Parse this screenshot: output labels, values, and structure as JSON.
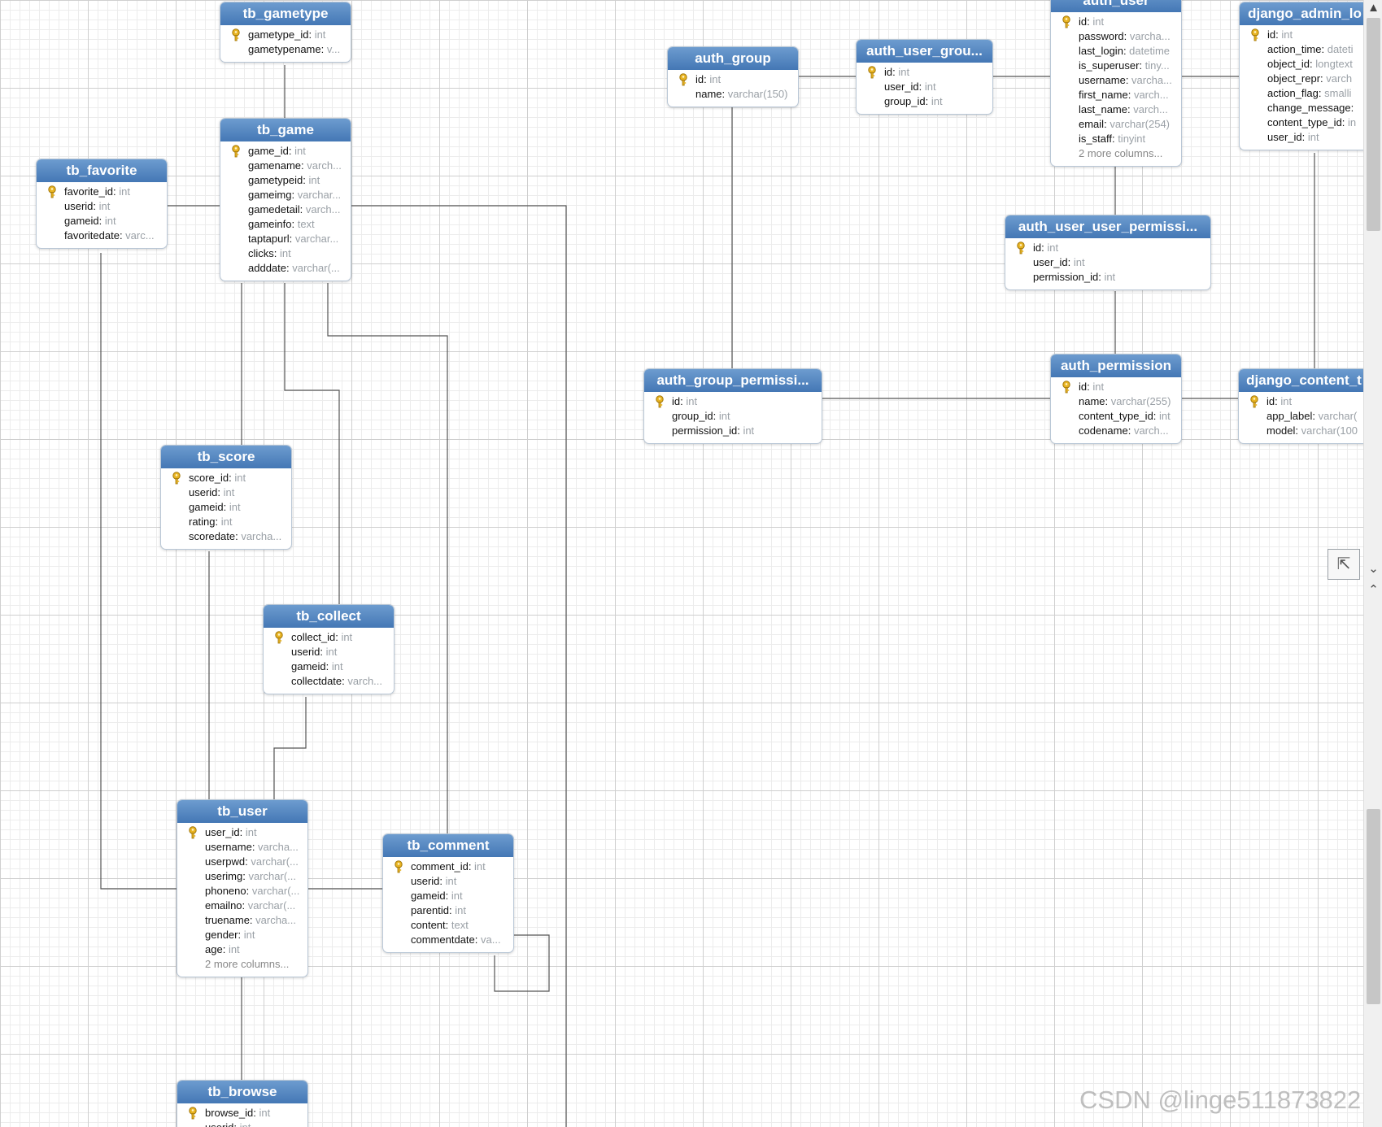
{
  "tables": [
    {
      "id": "tb_gametype",
      "name": "tb_gametype",
      "pos": [
        270,
        2,
        160
      ],
      "fields": [
        {
          "pk": true,
          "name": "gametype_id",
          "type": "int"
        },
        {
          "name": "gametypename",
          "type": "v..."
        }
      ]
    },
    {
      "id": "tb_game",
      "name": "tb_game",
      "pos": [
        270,
        145,
        160
      ],
      "fields": [
        {
          "pk": true,
          "name": "game_id",
          "type": "int"
        },
        {
          "name": "gamename",
          "type": "varch..."
        },
        {
          "name": "gametypeid",
          "type": "int"
        },
        {
          "name": "gameimg",
          "type": "varchar..."
        },
        {
          "name": "gamedetail",
          "type": "varch..."
        },
        {
          "name": "gameinfo",
          "type": "text"
        },
        {
          "name": "taptapurl",
          "type": "varchar..."
        },
        {
          "name": "clicks",
          "type": "int"
        },
        {
          "name": "adddate",
          "type": "varchar(..."
        }
      ]
    },
    {
      "id": "tb_favorite",
      "name": "tb_favorite",
      "pos": [
        44,
        195,
        160
      ],
      "fields": [
        {
          "pk": true,
          "name": "favorite_id",
          "type": "int"
        },
        {
          "name": "userid",
          "type": "int"
        },
        {
          "name": "gameid",
          "type": "int"
        },
        {
          "name": "favoritedate",
          "type": "varc..."
        }
      ]
    },
    {
      "id": "tb_score",
      "name": "tb_score",
      "pos": [
        197,
        547,
        160
      ],
      "fields": [
        {
          "pk": true,
          "name": "score_id",
          "type": "int"
        },
        {
          "name": "userid",
          "type": "int"
        },
        {
          "name": "gameid",
          "type": "int"
        },
        {
          "name": "rating",
          "type": "int"
        },
        {
          "name": "scoredate",
          "type": "varcha..."
        }
      ]
    },
    {
      "id": "tb_collect",
      "name": "tb_collect",
      "pos": [
        323,
        743,
        160
      ],
      "fields": [
        {
          "pk": true,
          "name": "collect_id",
          "type": "int"
        },
        {
          "name": "userid",
          "type": "int"
        },
        {
          "name": "gameid",
          "type": "int"
        },
        {
          "name": "collectdate",
          "type": "varch..."
        }
      ]
    },
    {
      "id": "tb_user",
      "name": "tb_user",
      "pos": [
        217,
        983,
        160
      ],
      "fields": [
        {
          "pk": true,
          "name": "user_id",
          "type": "int"
        },
        {
          "name": "username",
          "type": "varcha..."
        },
        {
          "name": "userpwd",
          "type": "varchar(..."
        },
        {
          "name": "userimg",
          "type": "varchar(..."
        },
        {
          "name": "phoneno",
          "type": "varchar(..."
        },
        {
          "name": "emailno",
          "type": "varchar(..."
        },
        {
          "name": "truename",
          "type": "varcha..."
        },
        {
          "name": "gender",
          "type": "int"
        },
        {
          "name": "age",
          "type": "int"
        }
      ],
      "more": "2 more columns..."
    },
    {
      "id": "tb_comment",
      "name": "tb_comment",
      "pos": [
        470,
        1025,
        160
      ],
      "fields": [
        {
          "pk": true,
          "name": "comment_id",
          "type": "int"
        },
        {
          "name": "userid",
          "type": "int"
        },
        {
          "name": "gameid",
          "type": "int"
        },
        {
          "name": "parentid",
          "type": "int"
        },
        {
          "name": "content",
          "type": "text"
        },
        {
          "name": "commentdate",
          "type": "va..."
        }
      ]
    },
    {
      "id": "tb_browse",
      "name": "tb_browse",
      "pos": [
        217,
        1328,
        160
      ],
      "fields": [
        {
          "pk": true,
          "name": "browse_id",
          "type": "int"
        },
        {
          "name": "userid",
          "type": "int"
        }
      ]
    },
    {
      "id": "auth_group",
      "name": "auth_group",
      "pos": [
        820,
        57,
        160
      ],
      "fields": [
        {
          "pk": true,
          "name": "id",
          "type": "int"
        },
        {
          "name": "name",
          "type": "varchar(150)"
        }
      ]
    },
    {
      "id": "auth_user_groups",
      "name": "auth_user_grou...",
      "pos": [
        1052,
        48,
        167
      ],
      "fields": [
        {
          "pk": true,
          "name": "id",
          "type": "int"
        },
        {
          "name": "user_id",
          "type": "int"
        },
        {
          "name": "group_id",
          "type": "int"
        }
      ]
    },
    {
      "id": "auth_user",
      "name": "auth_user",
      "pos": [
        1291,
        -14,
        160
      ],
      "fields": [
        {
          "pk": true,
          "name": "id",
          "type": "int"
        },
        {
          "name": "password",
          "type": "varcha..."
        },
        {
          "name": "last_login",
          "type": "datetime"
        },
        {
          "name": "is_superuser",
          "type": "tiny..."
        },
        {
          "name": "username",
          "type": "varcha..."
        },
        {
          "name": "first_name",
          "type": "varch..."
        },
        {
          "name": "last_name",
          "type": "varch..."
        },
        {
          "name": "email",
          "type": "varchar(254)"
        },
        {
          "name": "is_staff",
          "type": "tinyint"
        }
      ],
      "more": "2 more columns..."
    },
    {
      "id": "django_admin_log",
      "name": "django_admin_lo",
      "pos": [
        1523,
        2,
        160
      ],
      "fields": [
        {
          "pk": true,
          "name": "id",
          "type": "int"
        },
        {
          "name": "action_time",
          "type": "dateti"
        },
        {
          "name": "object_id",
          "type": "longtext"
        },
        {
          "name": "object_repr",
          "type": "varch"
        },
        {
          "name": "action_flag",
          "type": "smalli"
        },
        {
          "name": "change_message",
          "type": ""
        },
        {
          "name": "content_type_id",
          "type": "in"
        },
        {
          "name": "user_id",
          "type": "int"
        }
      ]
    },
    {
      "id": "auth_user_user_permissions",
      "name": "auth_user_user_permissi...",
      "pos": [
        1235,
        264,
        252
      ],
      "fields": [
        {
          "pk": true,
          "name": "id",
          "type": "int"
        },
        {
          "name": "user_id",
          "type": "int"
        },
        {
          "name": "permission_id",
          "type": "int"
        }
      ]
    },
    {
      "id": "auth_group_permissions",
      "name": "auth_group_permissi...",
      "pos": [
        791,
        453,
        218
      ],
      "fields": [
        {
          "pk": true,
          "name": "id",
          "type": "int"
        },
        {
          "name": "group_id",
          "type": "int"
        },
        {
          "name": "permission_id",
          "type": "int"
        }
      ]
    },
    {
      "id": "auth_permission",
      "name": "auth_permission",
      "pos": [
        1291,
        435,
        160
      ],
      "fields": [
        {
          "pk": true,
          "name": "id",
          "type": "int"
        },
        {
          "name": "name",
          "type": "varchar(255)"
        },
        {
          "name": "content_type_id",
          "type": "int"
        },
        {
          "name": "codename",
          "type": "varch..."
        }
      ]
    },
    {
      "id": "django_content_type",
      "name": "django_content_t",
      "pos": [
        1522,
        453,
        160
      ],
      "fields": [
        {
          "pk": true,
          "name": "id",
          "type": "int"
        },
        {
          "name": "app_label",
          "type": "varchar("
        },
        {
          "name": "model",
          "type": "varchar(100"
        }
      ]
    }
  ],
  "links": [
    [
      [
        350,
        80
      ],
      [
        350,
        145
      ]
    ],
    [
      [
        205,
        253
      ],
      [
        270,
        253
      ]
    ],
    [
      [
        430,
        253
      ],
      [
        696,
        253
      ],
      [
        696,
        1386
      ]
    ],
    [
      [
        297,
        348
      ],
      [
        297,
        547
      ]
    ],
    [
      [
        350,
        348
      ],
      [
        350,
        480
      ],
      [
        417,
        480
      ],
      [
        417,
        743
      ]
    ],
    [
      [
        403,
        348
      ],
      [
        403,
        413
      ],
      [
        550,
        413
      ],
      [
        550,
        1025
      ]
    ],
    [
      [
        124,
        311
      ],
      [
        124,
        1093
      ],
      [
        217,
        1093
      ]
    ],
    [
      [
        257,
        678
      ],
      [
        257,
        983
      ]
    ],
    [
      [
        376,
        857
      ],
      [
        376,
        920
      ],
      [
        337,
        920
      ],
      [
        337,
        983
      ]
    ],
    [
      [
        377,
        1093
      ],
      [
        470,
        1093
      ]
    ],
    [
      [
        297,
        1202
      ],
      [
        297,
        1328
      ]
    ],
    [
      [
        630,
        1150
      ],
      [
        675,
        1150
      ],
      [
        675,
        1219
      ],
      [
        608,
        1219
      ],
      [
        608,
        1175
      ]
    ],
    [
      [
        980,
        94
      ],
      [
        1052,
        94
      ]
    ],
    [
      [
        1219,
        94
      ],
      [
        1291,
        94
      ]
    ],
    [
      [
        1451,
        94
      ],
      [
        1523,
        94
      ]
    ],
    [
      [
        900,
        132
      ],
      [
        900,
        453
      ]
    ],
    [
      [
        1371,
        202
      ],
      [
        1371,
        264
      ]
    ],
    [
      [
        1371,
        358
      ],
      [
        1371,
        435
      ]
    ],
    [
      [
        1009,
        490
      ],
      [
        1291,
        490
      ]
    ],
    [
      [
        1451,
        490
      ],
      [
        1522,
        490
      ]
    ],
    [
      [
        1616,
        188
      ],
      [
        1616,
        453
      ]
    ]
  ],
  "ui": {
    "scroll_up": "▲",
    "scroll_down": "▼",
    "fit_icon": "⇱",
    "mini_up": "⌃",
    "mini_down": "⌄"
  },
  "watermark": "CSDN @linge511873822"
}
